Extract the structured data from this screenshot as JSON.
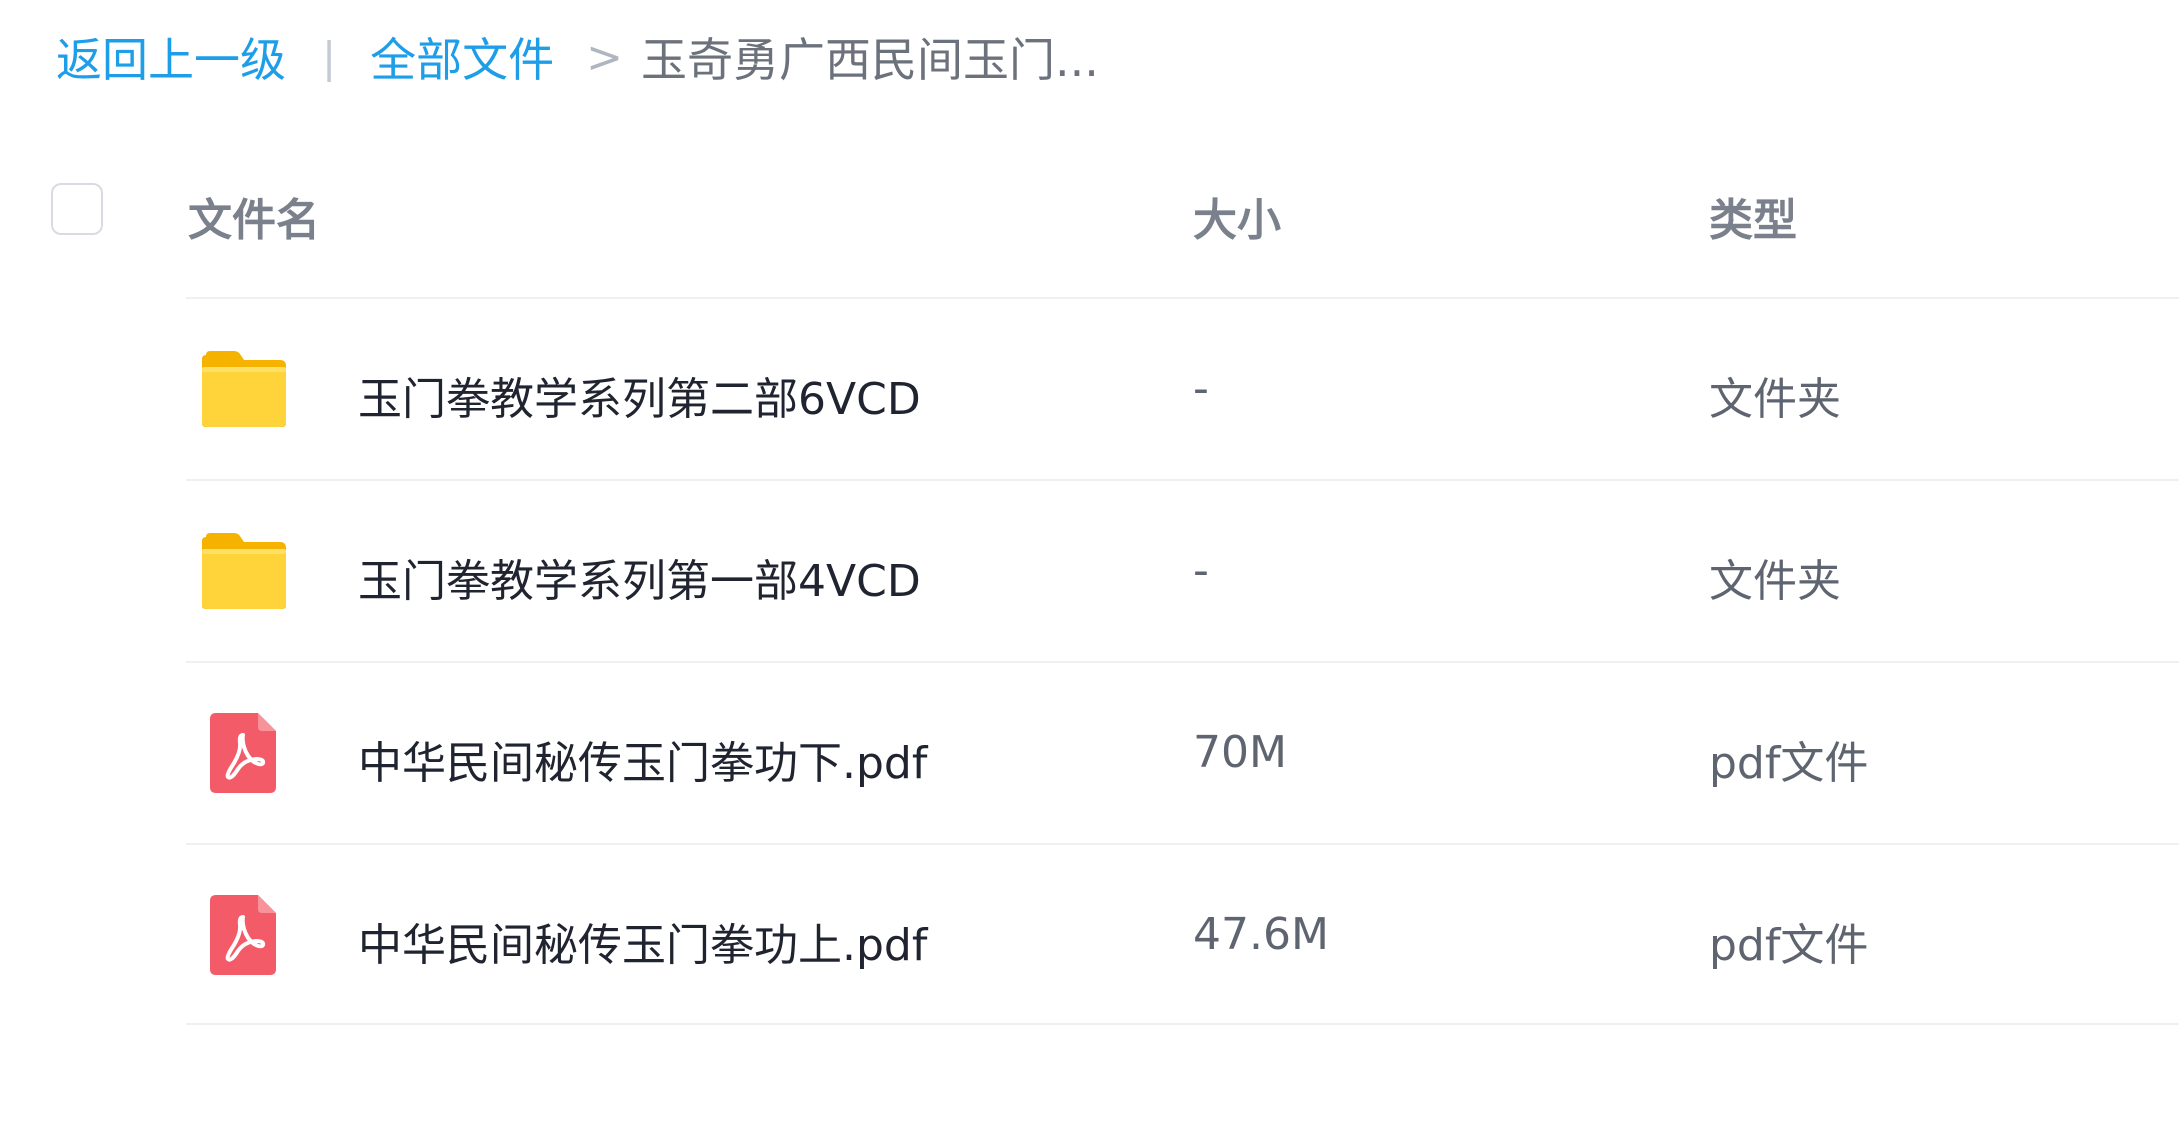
{
  "breadcrumb": {
    "back": "返回上一级",
    "divider": "|",
    "root": "全部文件",
    "arrow": ">",
    "current": "玉奇勇广西民间玉门..."
  },
  "table": {
    "headers": {
      "name": "文件名",
      "size": "大小",
      "type": "类型"
    },
    "rows": [
      {
        "icon": "folder-icon",
        "name": "玉门拳教学系列第二部6VCD",
        "size": "-",
        "type": "文件夹"
      },
      {
        "icon": "folder-icon",
        "name": "玉门拳教学系列第一部4VCD",
        "size": "-",
        "type": "文件夹"
      },
      {
        "icon": "pdf-icon",
        "name": "中华民间秘传玉门拳功下.pdf",
        "size": "70M",
        "type": "pdf文件"
      },
      {
        "icon": "pdf-icon",
        "name": "中华民间秘传玉门拳功上.pdf",
        "size": "47.6M",
        "type": "pdf文件"
      }
    ]
  },
  "colors": {
    "link": "#1e9ee8",
    "folder": "#ffc92e",
    "pdf": "#f45b69"
  }
}
